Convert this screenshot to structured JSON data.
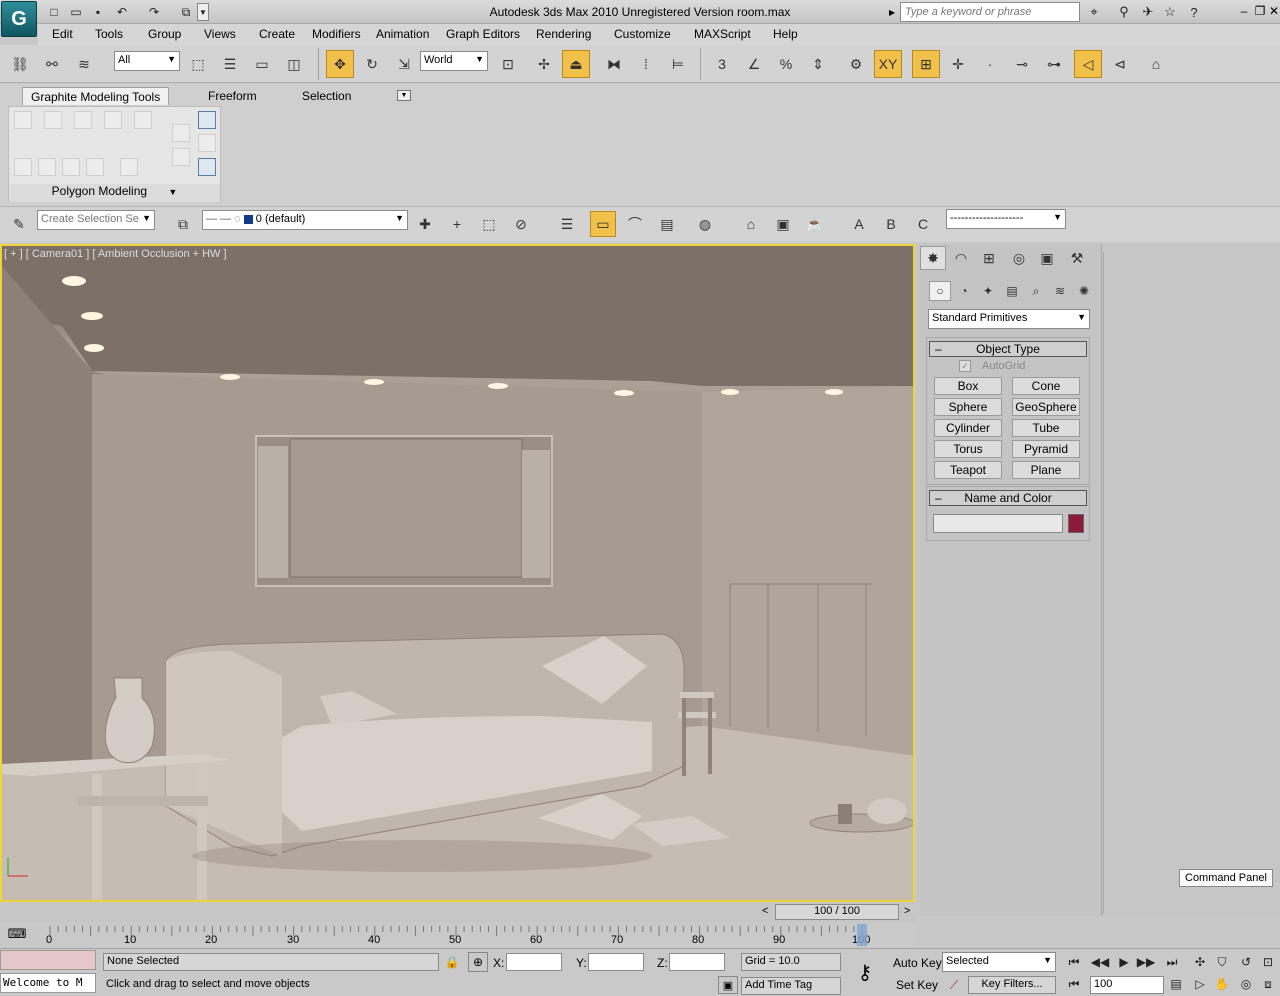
{
  "title": "Autodesk 3ds Max  2010    Unregistered Version      room.max",
  "search_placeholder": "Type a keyword or phrase",
  "menu": [
    "Edit",
    "Tools",
    "Group",
    "Views",
    "Create",
    "Modifiers",
    "Animation",
    "Graph Editors",
    "Rendering",
    "Customize",
    "MAXScript",
    "Help"
  ],
  "toolbar": {
    "selection_filter": "All",
    "ref_coord": "World"
  },
  "ribbon": {
    "tabs": [
      "Graphite Modeling Tools",
      "Freeform",
      "Selection"
    ],
    "panel_title": "Polygon Modeling"
  },
  "layers": {
    "named_selection_placeholder": "Create Selection Se",
    "current_layer": "0 (default)",
    "abc_labels": [
      "A",
      "B",
      "C"
    ],
    "line_style": "--------------------"
  },
  "viewport": {
    "label": "[ + ] [ Camera01 ] [ Ambient Occlusion + HW ]"
  },
  "command_panel": {
    "dropdown": "Standard Primitives",
    "object_type_title": "Object Type",
    "autogrid": "AutoGrid",
    "buttons": [
      "Box",
      "Cone",
      "Sphere",
      "GeoSphere",
      "Cylinder",
      "Tube",
      "Torus",
      "Pyramid",
      "Teapot",
      "Plane"
    ],
    "name_color_title": "Name and Color",
    "name_value": "",
    "color": "#8b1a3b"
  },
  "tooltip": "Command Panel",
  "timeline": {
    "frame_display": "100 / 100",
    "ticks": [
      "0",
      "10",
      "20",
      "30",
      "40",
      "50",
      "60",
      "70",
      "80",
      "90",
      "100"
    ],
    "prev": "<",
    "next": ">"
  },
  "status": {
    "selection": "None Selected",
    "prompt": "Click and drag to select and move objects",
    "x_label": "X:",
    "y_label": "Y:",
    "z_label": "Z:",
    "x": "",
    "y": "",
    "z": "",
    "grid": "Grid = 10.0",
    "add_time_tag": "Add Time Tag",
    "auto_key": "Auto Key",
    "set_key": "Set Key",
    "key_mode": "Selected",
    "key_filters": "Key Filters...",
    "current_frame": "100",
    "listener": "Welcome to M"
  }
}
